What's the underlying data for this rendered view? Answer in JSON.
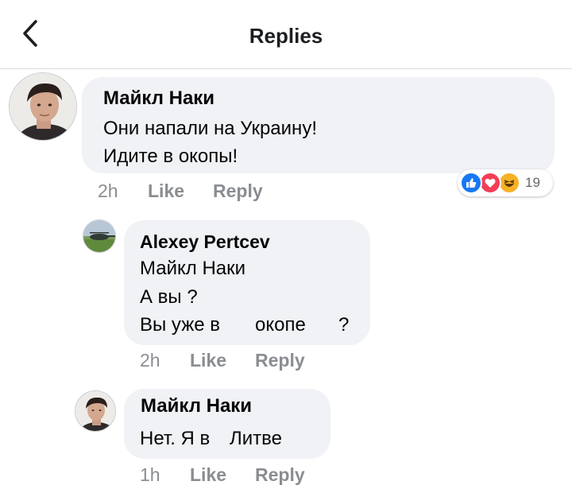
{
  "header": {
    "title": "Replies"
  },
  "comments": [
    {
      "author": "Майкл Наки",
      "lines": [
        "Они напали на Украину!",
        "Идите в окопы!"
      ],
      "time": "2h",
      "like": "Like",
      "reply": "Reply",
      "reactions": {
        "icons": [
          "like-icon",
          "love-icon",
          "haha-icon"
        ],
        "count": "19"
      }
    },
    {
      "author": "Alexey Pertcev",
      "lines": [
        "Майкл Наки",
        "А вы ?",
        "Вы уже в",
        "окопе",
        "?"
      ],
      "time": "2h",
      "like": "Like",
      "reply": "Reply"
    },
    {
      "author": "Майкл Наки",
      "lines": [
        "Нет. Я в",
        "Литве"
      ],
      "time": "1h",
      "like": "Like",
      "reply": "Reply"
    }
  ],
  "colors": {
    "bubble": "#f0f2f5",
    "meta_text": "#8a8d91",
    "like_blue": "#1877f2",
    "love_red": "#f33e58",
    "haha_yellow": "#f7b125"
  }
}
